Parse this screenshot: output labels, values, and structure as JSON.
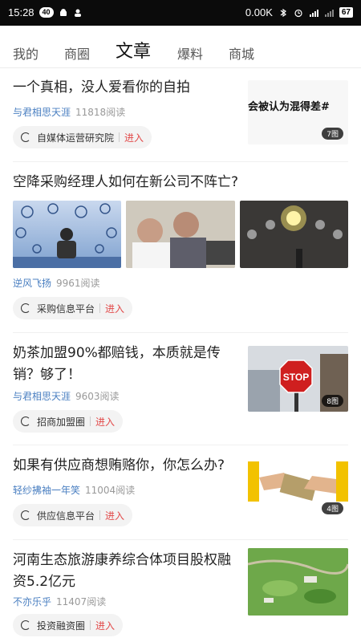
{
  "status": {
    "time": "15:28",
    "badge": "40",
    "network_speed": "0.00K",
    "battery": "67"
  },
  "tabs": [
    {
      "label": "我的"
    },
    {
      "label": "商圈"
    },
    {
      "label": "文章"
    },
    {
      "label": "爆料"
    },
    {
      "label": "商城"
    }
  ],
  "articles": [
    {
      "title": "一个真相，没人爱看你的自拍",
      "author": "与君相思天涯",
      "reads": "11818阅读",
      "chip_label": "自媒体运营研究院",
      "chip_action": "进入",
      "thumb_text": "会被认为混得差#",
      "image_count": "7图"
    },
    {
      "title": "空降采购经理人如何在新公司不阵亡?",
      "author": "逆风飞扬",
      "reads": "9961阅读",
      "chip_label": "采购信息平台",
      "chip_action": "进入"
    },
    {
      "title_line1": "奶茶加盟90%都赔钱，本质就是传",
      "title_line2": "销？够了！",
      "author": "与君相思天涯",
      "reads": "9603阅读",
      "chip_label": "招商加盟圈",
      "chip_action": "进入",
      "stop_text": "STOP",
      "image_count": "8图"
    },
    {
      "title": "如果有供应商想贿赂你，你怎么办?",
      "author": "轻纱拂袖一年笑",
      "reads": "11004阅读",
      "chip_label": "供应信息平台",
      "chip_action": "进入",
      "image_count": "4图"
    },
    {
      "title_line1": "河南生态旅游康养综合体项目股权融",
      "title_line2": "资5.2亿元",
      "author": "不亦乐乎",
      "reads": "11407阅读",
      "chip_label": "投资融资圈",
      "chip_action": "进入"
    }
  ]
}
